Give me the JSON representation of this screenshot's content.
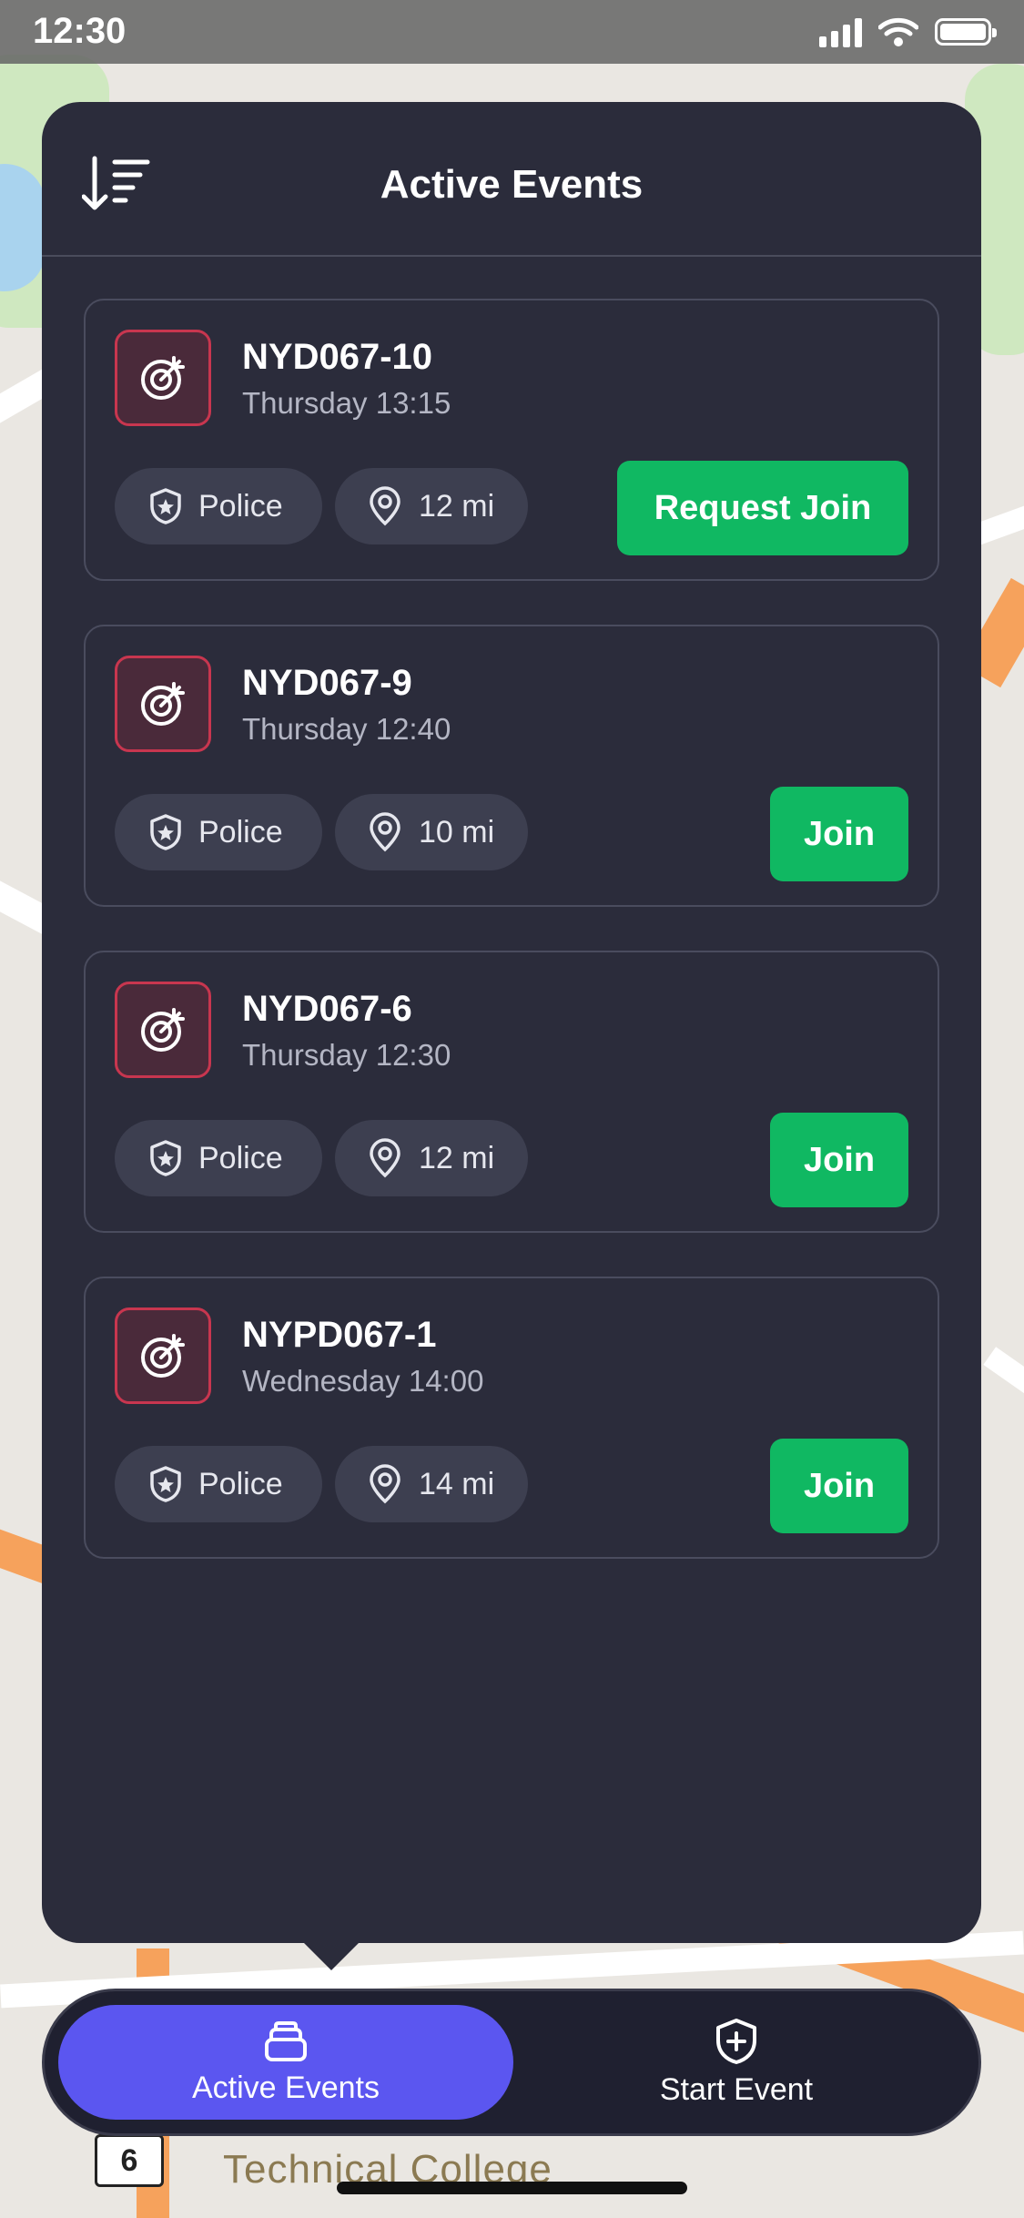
{
  "status_bar": {
    "time": "12:30"
  },
  "map": {
    "labels": [
      "Technical College",
      "6"
    ]
  },
  "panel": {
    "title": "Active Events",
    "events": [
      {
        "name": "NYD067-10",
        "time": "Thursday 13:15",
        "type": "Police",
        "distance": "12 mi",
        "action": "Request Join"
      },
      {
        "name": "NYD067-9",
        "time": "Thursday 12:40",
        "type": "Police",
        "distance": "10 mi",
        "action": "Join"
      },
      {
        "name": "NYD067-6",
        "time": "Thursday 12:30",
        "type": "Police",
        "distance": "12 mi",
        "action": "Join"
      },
      {
        "name": "NYPD067-1",
        "time": "Wednesday 14:00",
        "type": "Police",
        "distance": "14 mi",
        "action": "Join"
      }
    ]
  },
  "tab_bar": {
    "active_events": "Active Events",
    "start_event": "Start Event"
  },
  "colors": {
    "panel": "#2b2c3b",
    "accent": "#5b56f0",
    "join": "#10b862",
    "event_icon_border": "#c8364f"
  }
}
